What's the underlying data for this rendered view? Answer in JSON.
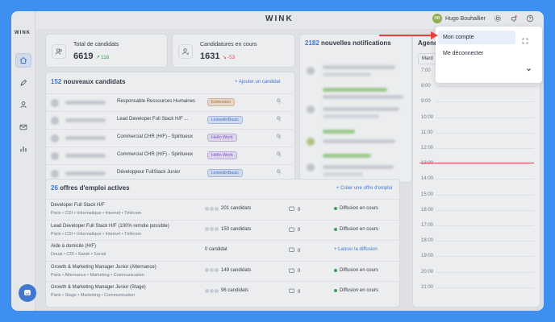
{
  "app": {
    "brand": "WINK",
    "sidebar_logo": "WINK"
  },
  "user": {
    "initials": "HB",
    "name": "Hugo Bouhallier"
  },
  "nav": [
    {
      "icon": "home-icon",
      "active": true
    },
    {
      "icon": "rocket-icon",
      "active": false
    },
    {
      "icon": "user-icon",
      "active": false
    },
    {
      "icon": "mail-icon",
      "active": false
    },
    {
      "icon": "chart-icon",
      "active": false
    }
  ],
  "stats": {
    "total": {
      "label": "Total de candidats",
      "value": "6619",
      "delta": "116"
    },
    "ongoing": {
      "label": "Candidatures en cours",
      "value": "1631",
      "delta": "-53"
    }
  },
  "notifications": {
    "count": "2182",
    "title": "nouvelles notifications"
  },
  "agenda": {
    "title": "Agenda",
    "select_value": "Mard",
    "times": [
      "7:00",
      "8:00",
      "9:00",
      "10:00",
      "11:00",
      "12:00",
      "13:00",
      "14:00",
      "15:00",
      "16:00",
      "17:00",
      "18:00",
      "19:00",
      "20:00",
      "21:00"
    ]
  },
  "candidates": {
    "count": "152",
    "title": "nouveaux candidats",
    "add_link": "+ Ajouter un candidat",
    "rows": [
      {
        "job": "Responsable Ressources Humaines",
        "tag": "Extension",
        "tag_color": "#f7e3cf",
        "tag_text": "#b36a1e",
        "age": "0j"
      },
      {
        "job": "Lead Developer Full Stack H/F ...",
        "tag": "LinkedinBasic",
        "tag_color": "#dfe8fb",
        "tag_text": "#2f6fd8",
        "age": "0j"
      },
      {
        "job": "Commercial CHR (H/F) - Spiritueux",
        "tag": "Hello Work",
        "tag_color": "#ece3fa",
        "tag_text": "#7a47c9",
        "age": "0j"
      },
      {
        "job": "Commercial CHR (H/F) - Spiritueux",
        "tag": "Hello Work",
        "tag_color": "#ece3fa",
        "tag_text": "#7a47c9",
        "age": "0j"
      },
      {
        "job": "Développeur FullStack Junior",
        "tag": "LinkedinBasic",
        "tag_color": "#dfe8fb",
        "tag_text": "#2f6fd8",
        "age": "0j"
      }
    ]
  },
  "offers": {
    "count": "26",
    "title": "offres d'emploi actives",
    "create_link": "+ Créer une offre d'emploi",
    "rows": [
      {
        "title": "Developer Full Stack H/F",
        "sub": "Paris • CDI • Informatique • Internet • Télécom",
        "candidates": "201 candidats",
        "dots": true,
        "messages": "0",
        "status": "Diffusion en cours",
        "action": false
      },
      {
        "title": "Lead Developer Full Stack H/F (100% remote possible)",
        "sub": "Paris • CDI • Informatique • Internet • Télécom",
        "candidates": "150 candidats",
        "dots": true,
        "messages": "0",
        "status": "Diffusion en cours",
        "action": false
      },
      {
        "title": "Aide à domicile (H/F)",
        "sub": "Douai • CDI • Santé • Social",
        "candidates": "0 candidat",
        "dots": false,
        "messages": "0",
        "status": "+ Lancer la diffusion",
        "action": true
      },
      {
        "title": "Growth & Marketing Manager Junior (Alternance)",
        "sub": "Paris • Alternance • Marketing • Communication",
        "candidates": "149 candidats",
        "dots": true,
        "messages": "0",
        "status": "Diffusion en cours",
        "action": false
      },
      {
        "title": "Growth & Marketing Manager Junior (Stage)",
        "sub": "Paris • Stage • Marketing • Communication",
        "candidates": "96 candidats",
        "dots": true,
        "messages": "0",
        "status": "Diffusion en cours",
        "action": false
      }
    ]
  },
  "dropdown": {
    "items": [
      "Mon compte",
      "Me déconnecter"
    ]
  },
  "colors": {
    "accent": "#2f6fd8",
    "arrow": "#e8413c",
    "now_line": "#e8413c",
    "page_bg": "#3d8ff0"
  }
}
